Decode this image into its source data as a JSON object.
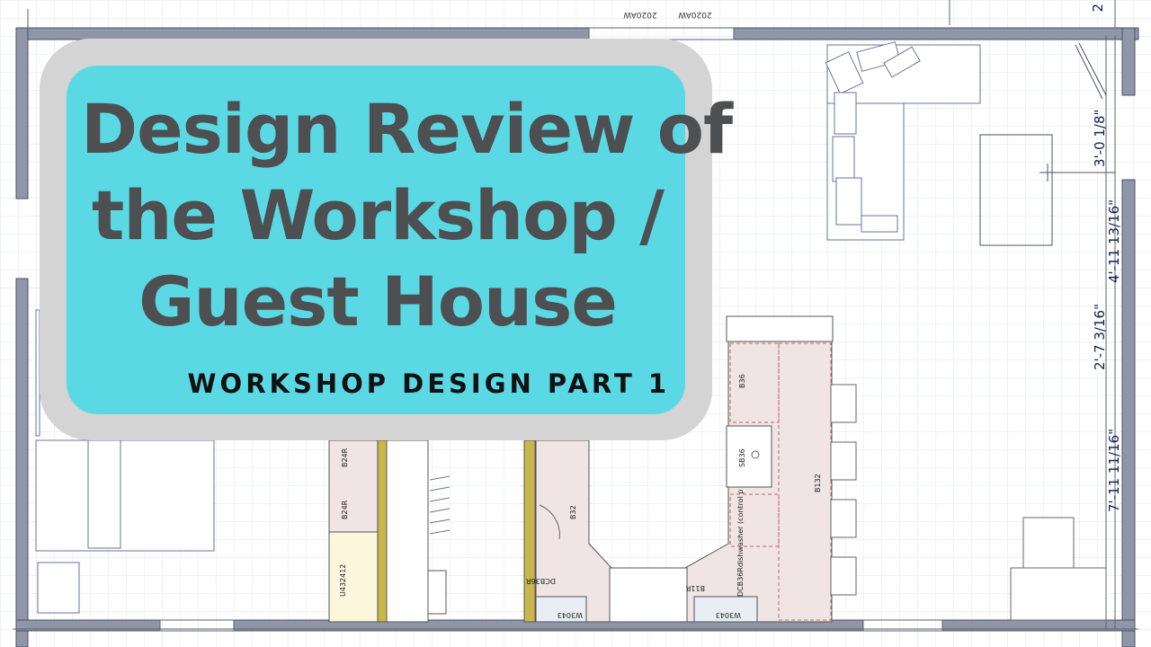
{
  "title_lines": [
    "Design Review of",
    "the Workshop /",
    "Guest House"
  ],
  "subtitle": "WORKSHOP DESIGN PART 1",
  "plan": {
    "dimensions": [
      "3'-0 1/8\"",
      "4'-11 13/16\"",
      "2'-7 3/16\"",
      "7'-11 11/16\""
    ],
    "window_labels": [
      "2020AW",
      "2020AW"
    ],
    "edge_label": "2",
    "cabinet_labels": [
      "B24R",
      "B24R",
      "U432412",
      "B32",
      "DCB36R",
      "B11R",
      "W3043",
      "W3043",
      "B36",
      "SB36",
      "B132",
      "DCB36Rdishwasher (control p"
    ]
  },
  "colors": {
    "card_frame": "#d4d4d4",
    "card_fill": "#5ad9e4",
    "title_text": "#4d4f51",
    "wall": "#8e96a8",
    "counter_fill": "#f0e4e4",
    "door_accent": "#c9b74b"
  }
}
